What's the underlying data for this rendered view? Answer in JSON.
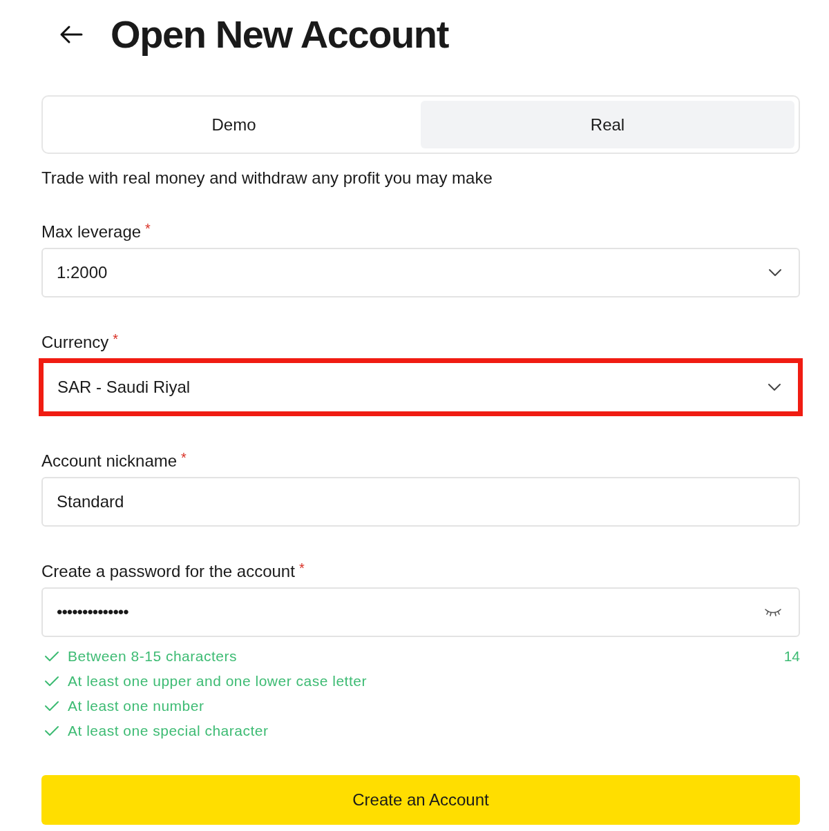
{
  "header": {
    "title": "Open New Account"
  },
  "tabs": [
    {
      "label": "Demo",
      "selected": false
    },
    {
      "label": "Real",
      "selected": true
    }
  ],
  "description": "Trade with real money and withdraw any profit you may make",
  "fields": [
    {
      "kind": "select",
      "label": "Max leverage",
      "required_mark": "*",
      "value": "1:2000",
      "highlighted": false
    },
    {
      "kind": "select",
      "label": "Currency",
      "required_mark": "*",
      "value": "SAR - Saudi Riyal",
      "highlighted": true
    },
    {
      "kind": "text",
      "label": "Account nickname",
      "required_mark": "*",
      "value": "Standard",
      "highlighted": false
    },
    {
      "kind": "password",
      "label": "Create a password for the account",
      "required_mark": "*",
      "value": "••••••••••••••",
      "highlighted": false
    }
  ],
  "password_rules": [
    {
      "text": "Between 8-15 characters",
      "met": true
    },
    {
      "text": "At least one upper and one lower case letter",
      "met": true
    },
    {
      "text": "At least one number",
      "met": true
    },
    {
      "text": "At least one special character",
      "met": true
    }
  ],
  "character_count": "14",
  "submit": "Create an Account"
}
